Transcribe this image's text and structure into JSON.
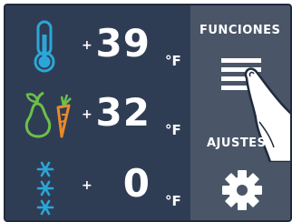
{
  "rows": [
    {
      "name": "fridge",
      "sign": "+",
      "value": "39",
      "unit": "°F",
      "icon": "thermometer-icon"
    },
    {
      "name": "fresh",
      "sign": "+",
      "value": "32",
      "unit": "°F",
      "icon": "pear-carrot-icon"
    },
    {
      "name": "freezer",
      "sign": "+",
      "value": "0",
      "unit": "°F",
      "icon": "snowflake-icon"
    }
  ],
  "panel": {
    "functions_label": "FUNCIONES",
    "settings_label": "AJUSTES",
    "functions_icon": "menu-icon",
    "settings_icon": "gear-icon"
  },
  "colors": {
    "accent_blue": "#2ba6d9",
    "accent_green": "#6cc04a",
    "accent_orange": "#e98a2b"
  }
}
